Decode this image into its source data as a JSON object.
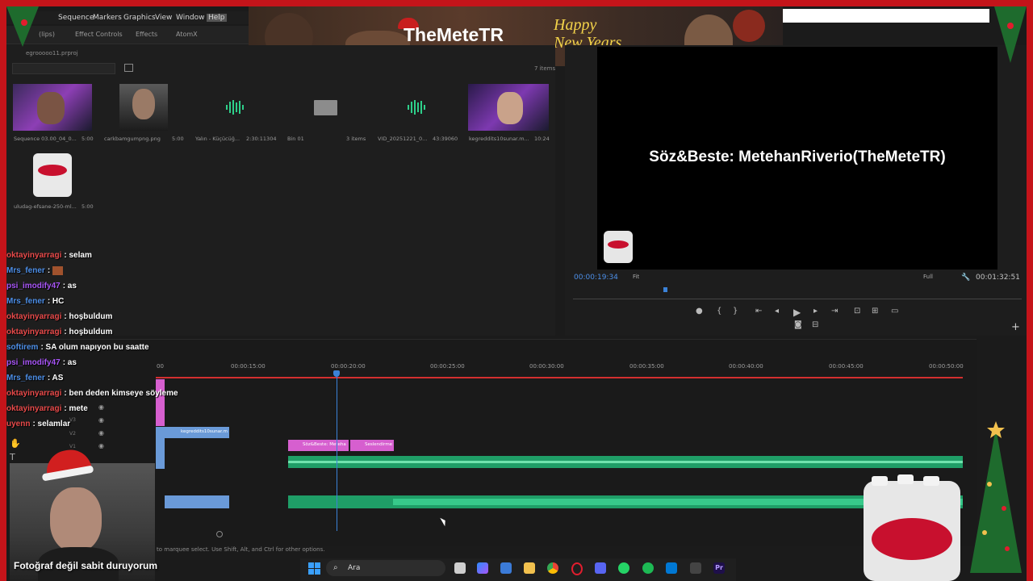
{
  "menu": {
    "items": [
      "Sequence",
      "Markers",
      "Graphics",
      "View",
      "Window",
      "Help"
    ]
  },
  "panel_tabs": [
    "(lips)",
    "Effect Controls",
    "Effects",
    "AtomX"
  ],
  "project": {
    "path": "egrooooo11.prproj",
    "items_count": "7 items",
    "thumbnails": [
      {
        "name": "Sequence 03.00_04_0...",
        "duration": "5:00"
      },
      {
        "name": "carkbamgumpng.png",
        "duration": "5:00"
      },
      {
        "name": "Yalın - Küçücüğ...",
        "duration": "2:30:11304"
      },
      {
        "name": "Bin 01",
        "duration": "3 items"
      },
      {
        "name": "VID_20251221_0...",
        "duration": "43:39060"
      },
      {
        "name": "kegreddits10sunar.m...",
        "duration": "10:24"
      },
      {
        "name": "uludag-efsane-250-ml...",
        "duration": "5:00"
      }
    ]
  },
  "banner": {
    "title": "TheMeteTR",
    "happy": "Happy",
    "new_years": "New Years"
  },
  "program": {
    "overlay_text": "Söz&Beste: MetehanRiverio(TheMeteTR)",
    "timecode_current": "00:00:19:34",
    "timecode_total": "00:01:32:51",
    "fit": "Fit",
    "resolution": "Full"
  },
  "timeline": {
    "ticks": [
      "00",
      "00:00:15:00",
      "00:00:20:00",
      "00:00:25:00",
      "00:00:30:00",
      "00:00:35:00",
      "00:00:40:00",
      "00:00:45:00",
      "00:00:50:00"
    ],
    "tracks": [
      "V3",
      "V2",
      "V1",
      "A1"
    ],
    "clips": {
      "kegreddits": "kegreddits10sunar.m",
      "soz": "Söz&Beste: Meteha",
      "seslendirme": "Seslendirme"
    },
    "status": "to marquee select. Use Shift, Alt, and Ctrl for other options."
  },
  "chat": [
    {
      "user": "oktayinyarragi",
      "msg": ": selam",
      "color": "#e84a4a"
    },
    {
      "user": "Mrs_fener",
      "msg": ": ",
      "color": "#4d8fe8"
    },
    {
      "user": "psi_imodify47",
      "msg": ": as",
      "color": "#a855f7"
    },
    {
      "user": "Mrs_fener",
      "msg": ": HC",
      "color": "#4d8fe8"
    },
    {
      "user": "oktayinyarragi",
      "msg": ": hoşbuldum",
      "color": "#e84a4a"
    },
    {
      "user": "oktayinyarragi",
      "msg": ": hoşbuldum",
      "color": "#e84a4a"
    },
    {
      "user": "softirem",
      "msg": ": SA olum napıyon bu saatte",
      "color": "#4d8fe8"
    },
    {
      "user": "psi_imodify47",
      "msg": ": as",
      "color": "#a855f7"
    },
    {
      "user": "Mrs_fener",
      "msg": ": AS",
      "color": "#4d8fe8"
    },
    {
      "user": "oktayinyarragi",
      "msg": ": ben deden kimseye söyleme",
      "color": "#e84a4a"
    },
    {
      "user": "oktayinyarragi",
      "msg": ": mete",
      "color": "#e84a4a"
    },
    {
      "user": "uyenn",
      "msg": ": selamlar",
      "color": "#e84a4a"
    }
  ],
  "webcam_caption": "Fotoğraf değil sabit duruyorum",
  "taskbar": {
    "search_placeholder": "Ara",
    "premiere_label": "Pr"
  }
}
